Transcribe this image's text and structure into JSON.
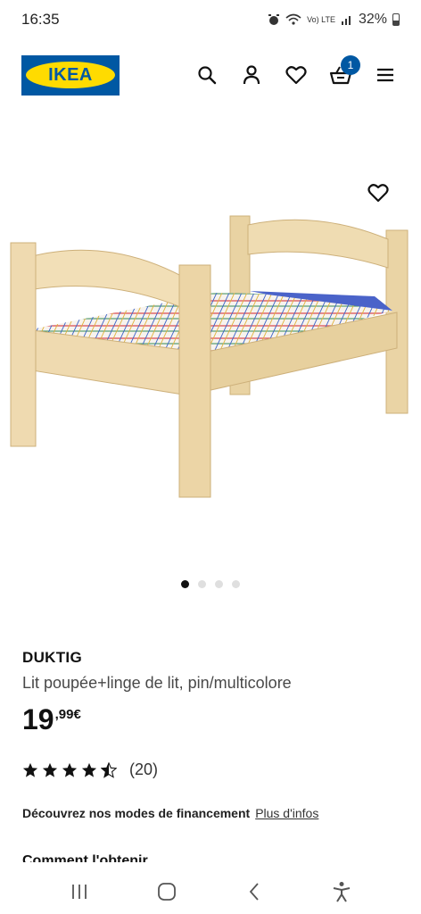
{
  "status_bar": {
    "time": "16:35",
    "network": "Vo) LTE",
    "battery": "32%"
  },
  "header": {
    "logo_text": "IKEA",
    "cart_count": "1",
    "icons": [
      "search-icon",
      "user-icon",
      "heart-icon",
      "basket-icon",
      "menu-icon"
    ]
  },
  "carousel": {
    "count": 4,
    "active_index": 0
  },
  "product": {
    "name": "DUKTIG",
    "description": "Lit poupée+linge de lit, pin/multicolore",
    "price_integer": "19",
    "price_decimal": ",99€",
    "rating_stars": 4.5,
    "rating_count": "(20)"
  },
  "financing": {
    "text": "Découvrez nos modes de financement",
    "link": "Plus d'infos"
  },
  "obtain": {
    "heading": "Comment l'obtenir"
  },
  "colors": {
    "ikea_blue": "#0058a3",
    "ikea_yellow": "#ffdb00"
  }
}
